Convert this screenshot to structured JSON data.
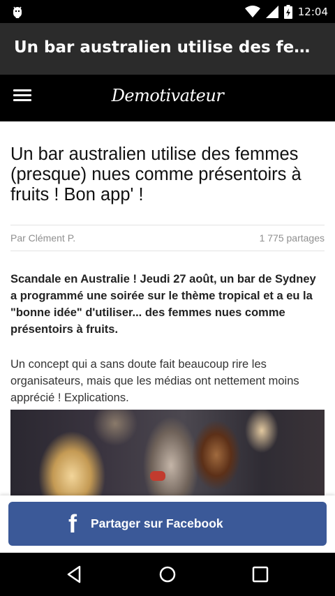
{
  "status_bar": {
    "time": "12:04",
    "icons": [
      "android-debug-icon",
      "wifi-icon",
      "cell-signal-icon",
      "battery-charging-icon"
    ]
  },
  "app_bar": {
    "title": "Un bar australien utilise des femmes (presque) nues comme présentoirs à fruits ! Bon app' !"
  },
  "site_header": {
    "logo_text": "Demotivateur",
    "menu_icon": "hamburger-menu-icon"
  },
  "article": {
    "headline": "Un bar australien utilise des femmes (presque) nues comme présentoirs à fruits ! Bon app' !",
    "author": "Par Clément P.",
    "shares": "1 775 partages",
    "lead": "Scandale en Australie ! Jeudi 27 août, un bar de Sydney a programmé une soirée sur le thème tropical et a eu la \"bonne idée\" d'utiliser... des femmes nues comme présentoirs à fruits.",
    "paragraph": "Un concept qui a sans doute fait beaucoup rire les organisateurs, mais que les médias ont nettement moins apprécié ! Explications."
  },
  "share_bar": {
    "icon_glyph": "f",
    "label": "Partager sur Facebook",
    "color": "#3b5998"
  },
  "nav_bar": {
    "buttons": [
      "back-icon",
      "home-icon",
      "recents-icon"
    ]
  }
}
